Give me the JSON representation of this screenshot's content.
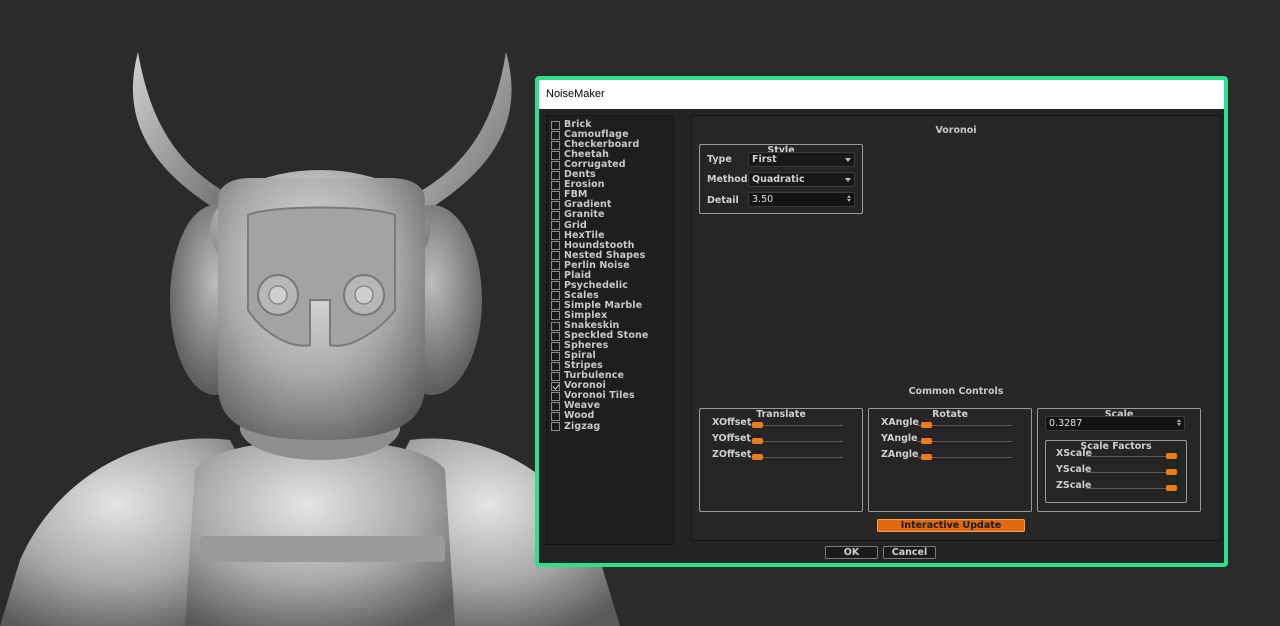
{
  "dialog": {
    "title": "NoiseMaker",
    "accent_color": "#2ee08e",
    "noise_types": [
      {
        "label": "Brick",
        "checked": false
      },
      {
        "label": "Camouflage",
        "checked": false
      },
      {
        "label": "Checkerboard",
        "checked": false
      },
      {
        "label": "Cheetah",
        "checked": false
      },
      {
        "label": "Corrugated",
        "checked": false
      },
      {
        "label": "Dents",
        "checked": false
      },
      {
        "label": "Erosion",
        "checked": false
      },
      {
        "label": "FBM",
        "checked": false
      },
      {
        "label": "Gradient",
        "checked": false
      },
      {
        "label": "Granite",
        "checked": false
      },
      {
        "label": "Grid",
        "checked": false
      },
      {
        "label": "HexTile",
        "checked": false
      },
      {
        "label": "Houndstooth",
        "checked": false
      },
      {
        "label": "Nested Shapes",
        "checked": false
      },
      {
        "label": "Perlin Noise",
        "checked": false
      },
      {
        "label": "Plaid",
        "checked": false
      },
      {
        "label": "Psychedelic",
        "checked": false
      },
      {
        "label": "Scales",
        "checked": false
      },
      {
        "label": "Simple Marble",
        "checked": false
      },
      {
        "label": "Simplex",
        "checked": false
      },
      {
        "label": "Snakeskin",
        "checked": false
      },
      {
        "label": "Speckled Stone",
        "checked": false
      },
      {
        "label": "Spheres",
        "checked": false
      },
      {
        "label": "Spiral",
        "checked": false
      },
      {
        "label": "Stripes",
        "checked": false
      },
      {
        "label": "Turbulence",
        "checked": false
      },
      {
        "label": "Voronoi",
        "checked": true
      },
      {
        "label": "Voronoi Tiles",
        "checked": false
      },
      {
        "label": "Weave",
        "checked": false
      },
      {
        "label": "Wood",
        "checked": false
      },
      {
        "label": "Zigzag",
        "checked": false
      }
    ],
    "panel_title": "Voronoi",
    "style": {
      "title": "Style",
      "type_label": "Type",
      "type_value": "First",
      "method_label": "Method",
      "method_value": "Quadratic",
      "detail_label": "Detail",
      "detail_value": "3.50"
    },
    "common_controls_title": "Common Controls",
    "translate": {
      "title": "Translate",
      "sliders": [
        {
          "label": "XOffset",
          "value": 0.09
        },
        {
          "label": "YOffset",
          "value": 0.09
        },
        {
          "label": "ZOffset",
          "value": 0.09
        }
      ]
    },
    "rotate": {
      "title": "Rotate",
      "sliders": [
        {
          "label": "XAngle",
          "value": 0.09
        },
        {
          "label": "YAngle",
          "value": 0.09
        },
        {
          "label": "ZAngle",
          "value": 0.09
        }
      ]
    },
    "scale": {
      "title": "Scale",
      "value": "0.3287",
      "factors_title": "Scale Factors",
      "sliders": [
        {
          "label": "XScale",
          "value": 1.0
        },
        {
          "label": "YScale",
          "value": 1.0
        },
        {
          "label": "ZScale",
          "value": 1.0
        }
      ]
    },
    "interactive_update_label": "Interactive Update",
    "ok_label": "OK",
    "cancel_label": "Cancel",
    "slider_color": "#ef7a1a"
  }
}
